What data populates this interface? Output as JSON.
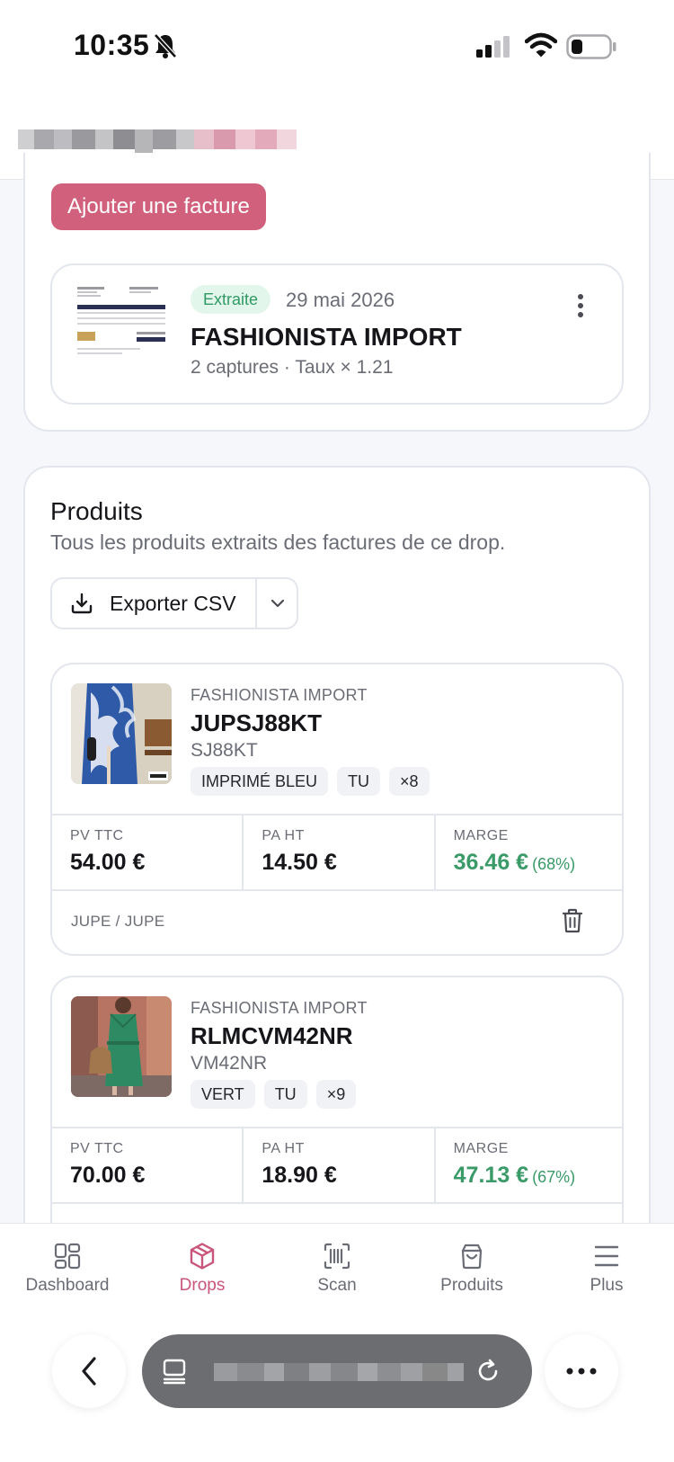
{
  "status_bar": {
    "time": "10:35"
  },
  "header": {},
  "invoices": {
    "add_button": "Ajouter une facture",
    "item": {
      "status": "Extraite",
      "date": "29 mai 2026",
      "supplier": "FASHIONISTA IMPORT",
      "meta": "2 captures · Taux × 1.21"
    }
  },
  "products": {
    "title": "Produits",
    "description": "Tous les produits extraits des factures de ce drop.",
    "export_label": "Exporter CSV",
    "column_labels": {
      "pv": "PV TTC",
      "pa": "PA HT",
      "marge": "MARGE"
    },
    "items": [
      {
        "brand": "FASHIONISTA IMPORT",
        "name": "JUPSJ88KT",
        "ref": "SJ88KT",
        "tags": [
          "IMPRIMÉ BLEU",
          "TU",
          "×8"
        ],
        "pv": "54.00 €",
        "pa": "14.50 €",
        "marge": "36.46 €",
        "marge_pct": "(68%)",
        "category": "JUPE / JUPE"
      },
      {
        "brand": "FASHIONISTA IMPORT",
        "name": "RLMCVM42NR",
        "ref": "VM42NR",
        "tags": [
          "VERT",
          "TU",
          "×9"
        ],
        "pv": "70.00 €",
        "pa": "18.90 €",
        "marge": "47.13 €",
        "marge_pct": "(67%)",
        "category": ""
      }
    ]
  },
  "tabbar": {
    "items": [
      {
        "label": "Dashboard",
        "icon": "grid-icon"
      },
      {
        "label": "Drops",
        "icon": "box-icon",
        "active": true
      },
      {
        "label": "Scan",
        "icon": "barcode-scan-icon"
      },
      {
        "label": "Produits",
        "icon": "shopping-bag-icon"
      },
      {
        "label": "Plus",
        "icon": "menu-icon"
      }
    ]
  },
  "colors": {
    "accent": "#d0607c",
    "active_tab": "#c9557a",
    "success": "#3a9a68",
    "badge_bg": "#e3f6ec"
  }
}
